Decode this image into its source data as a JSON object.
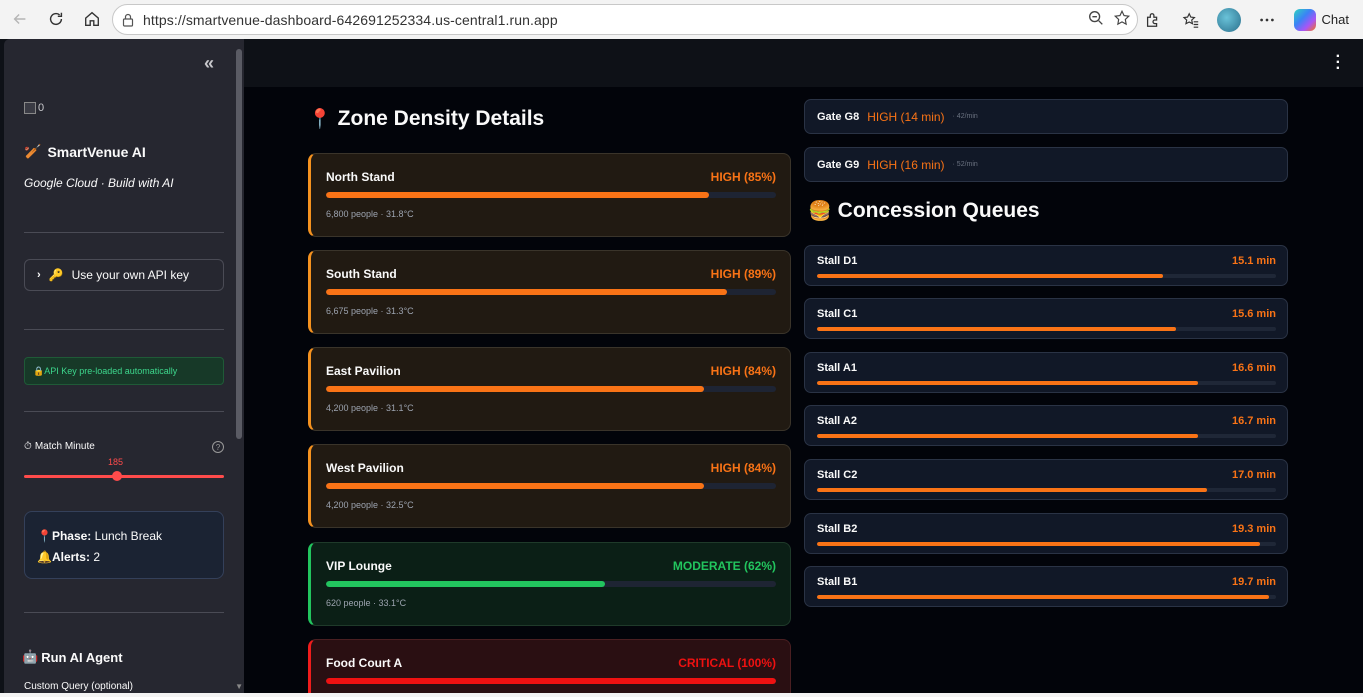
{
  "browser": {
    "url": "https://smartvenue-dashboard-642691252334.us-central1.run.app",
    "chat_label": "Chat"
  },
  "sidebar": {
    "logo_alt": "0",
    "brand": "SmartVenue AI",
    "tagline": "Google Cloud · Build with AI",
    "api_expander": "Use your own API key",
    "api_loaded": "API Key pre-loaded automatically",
    "slider": {
      "label": "Match Minute",
      "value": 185,
      "help": "?"
    },
    "phase_label": "Phase:",
    "phase_value": "Lunch Break",
    "alerts_label": "Alerts:",
    "alerts_value": "2",
    "run_agent": "Run AI Agent",
    "custom_query": "Custom Query (optional)"
  },
  "zones": {
    "title": "Zone Density Details",
    "items": [
      {
        "name": "North Stand",
        "status": "HIGH (85%)",
        "level": 0.85,
        "meta": "6,800 people · 31.8°C",
        "kind": "high"
      },
      {
        "name": "South Stand",
        "status": "HIGH (89%)",
        "level": 0.89,
        "meta": "6,675 people · 31.3°C",
        "kind": "high"
      },
      {
        "name": "East Pavilion",
        "status": "HIGH (84%)",
        "level": 0.84,
        "meta": "4,200 people · 31.1°C",
        "kind": "high"
      },
      {
        "name": "West Pavilion",
        "status": "HIGH (84%)",
        "level": 0.84,
        "meta": "4,200 people · 32.5°C",
        "kind": "high"
      },
      {
        "name": "VIP Lounge",
        "status": "MODERATE (62%)",
        "level": 0.62,
        "meta": "620 people · 33.1°C",
        "kind": "moderate"
      },
      {
        "name": "Food Court A",
        "status": "CRITICAL (100%)",
        "level": 1.0,
        "meta": "",
        "kind": "critical"
      }
    ]
  },
  "gates": [
    {
      "name": "Gate G8",
      "wait": "HIGH (14 min)",
      "rate": "· 42/min"
    },
    {
      "name": "Gate G9",
      "wait": "HIGH (16 min)",
      "rate": "· 52/min"
    }
  ],
  "concessions": {
    "title": "Concession Queues",
    "items": [
      {
        "name": "Stall D1",
        "wait": "15.1 min",
        "level": 0.753
      },
      {
        "name": "Stall C1",
        "wait": "15.6 min",
        "level": 0.783
      },
      {
        "name": "Stall A1",
        "wait": "16.6 min",
        "level": 0.83
      },
      {
        "name": "Stall A2",
        "wait": "16.7 min",
        "level": 0.83
      },
      {
        "name": "Stall C2",
        "wait": "17.0 min",
        "level": 0.85
      },
      {
        "name": "Stall B2",
        "wait": "19.3 min",
        "level": 0.965
      },
      {
        "name": "Stall B1",
        "wait": "19.7 min",
        "level": 0.985
      }
    ]
  },
  "colors": {
    "accent": "#f97316",
    "moderate": "#22c55e",
    "critical": "#ef1111",
    "slider": "#ff4b4b"
  }
}
